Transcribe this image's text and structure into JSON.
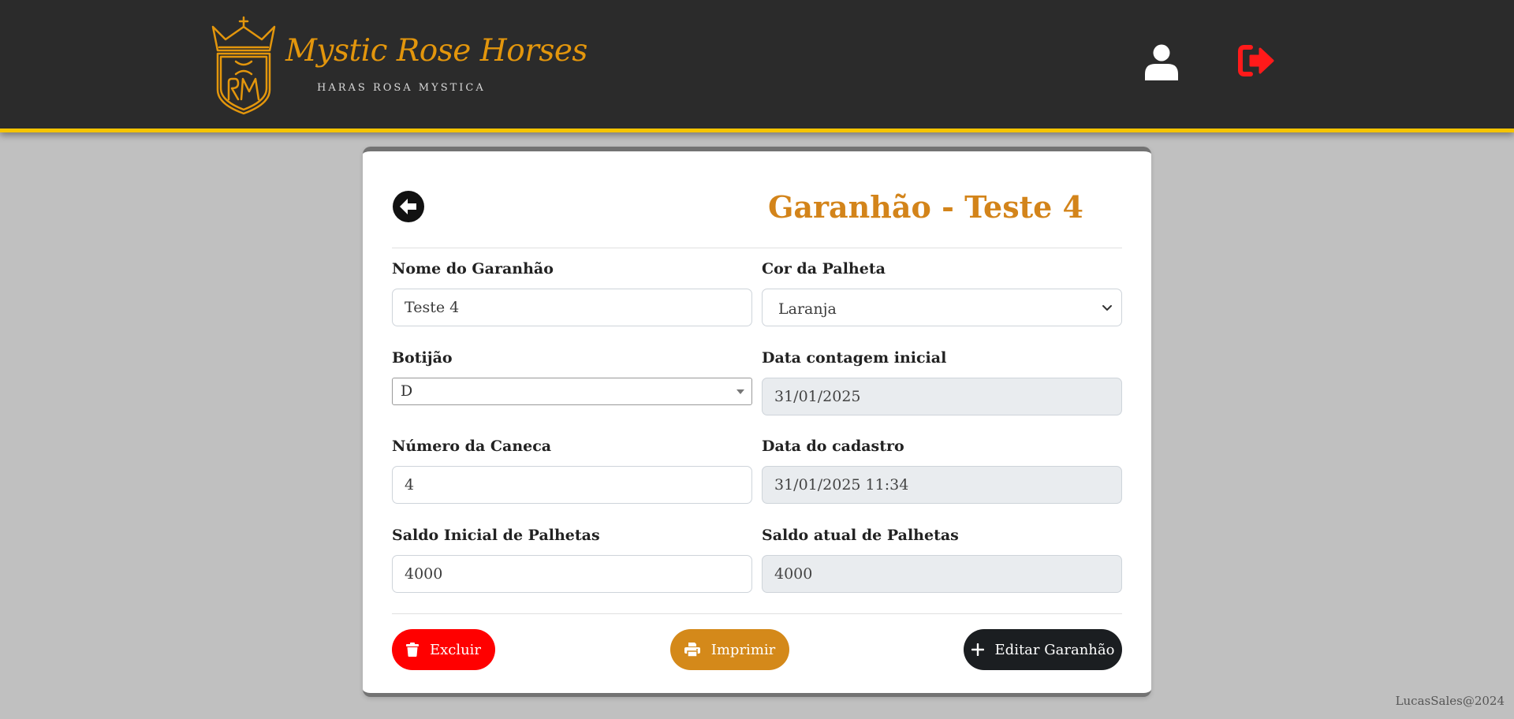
{
  "header": {
    "brand_title": "Mystic Rose Horses",
    "brand_subtitle": "HARAS ROSA MYSTICA"
  },
  "page": {
    "title": "Garanhão - Teste 4"
  },
  "form": {
    "nome_label": "Nome do Garanhão",
    "nome_value": "Teste 4",
    "cor_label": "Cor da Palheta",
    "cor_value": "Laranja",
    "botijao_label": "Botijão",
    "botijao_value": "D",
    "data_contagem_label": "Data contagem inicial",
    "data_contagem_value": "31/01/2025",
    "caneca_label": "Número da Caneca",
    "caneca_value": "4",
    "data_cadastro_label": "Data do cadastro",
    "data_cadastro_value": "31/01/2025 11:34",
    "saldo_inicial_label": "Saldo Inicial de Palhetas",
    "saldo_inicial_value": "4000",
    "saldo_atual_label": "Saldo atual de Palhetas",
    "saldo_atual_value": "4000"
  },
  "actions": {
    "delete_label": "Excluir",
    "print_label": "Imprimir",
    "edit_label": "Editar Garanhão"
  },
  "footer": {
    "credit": "LucasSales@2024"
  },
  "colors": {
    "accent": "#d3841a",
    "header_bg": "#2b2b2b",
    "header_border": "#f5c400",
    "danger": "#ff0000",
    "dark": "#1b1e21"
  },
  "icons": {
    "user": "user-icon",
    "logout": "logout-icon",
    "back": "arrow-left-circle-icon",
    "delete": "trash-icon",
    "print": "printer-icon",
    "edit": "plus-icon"
  }
}
